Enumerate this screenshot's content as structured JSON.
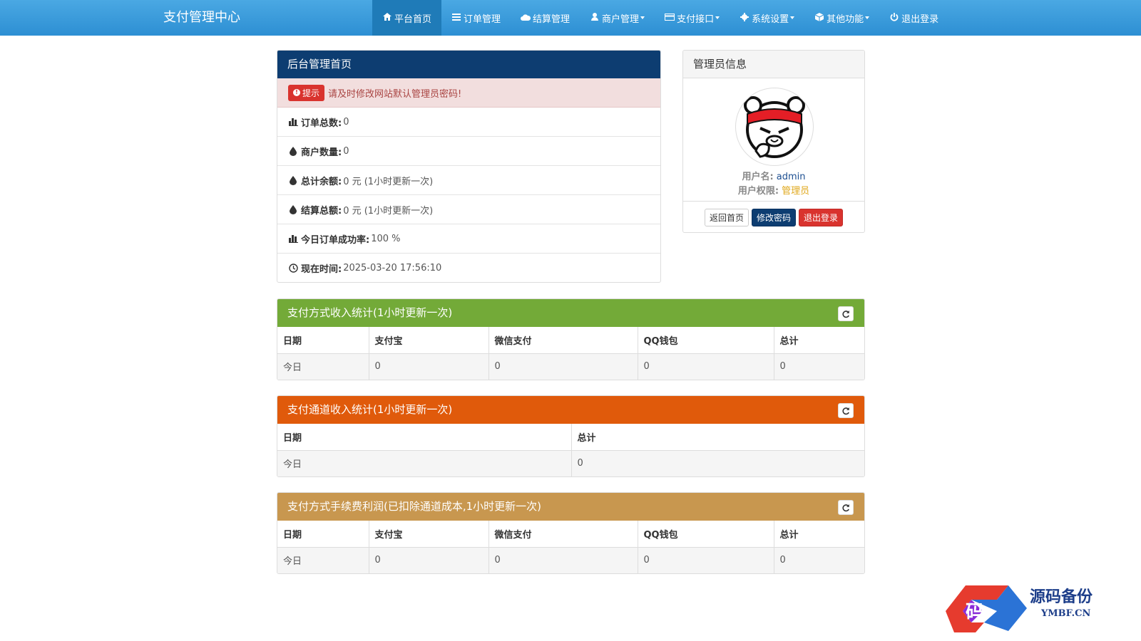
{
  "navbar": {
    "brand": "支付管理中心",
    "items": [
      {
        "label": "平台首页",
        "icon": "home-icon",
        "active": true,
        "dropdown": false
      },
      {
        "label": "订单管理",
        "icon": "list-icon",
        "active": false,
        "dropdown": false
      },
      {
        "label": "结算管理",
        "icon": "cloud-icon",
        "active": false,
        "dropdown": false
      },
      {
        "label": "商户管理",
        "icon": "user-icon",
        "active": false,
        "dropdown": true
      },
      {
        "label": "支付接口",
        "icon": "card-icon",
        "active": false,
        "dropdown": true
      },
      {
        "label": "系统设置",
        "icon": "gear-icon",
        "active": false,
        "dropdown": true
      },
      {
        "label": "其他功能",
        "icon": "cube-icon",
        "active": false,
        "dropdown": true
      },
      {
        "label": "退出登录",
        "icon": "power-icon",
        "active": false,
        "dropdown": false
      }
    ]
  },
  "main_panel": {
    "title": "后台管理首页",
    "alert_badge": "提示",
    "alert_text": "请及时修改网站默认管理员密码!",
    "stats": [
      {
        "icon": "bar-chart-icon",
        "label": "订单总数:",
        "value": "0"
      },
      {
        "icon": "drop-icon",
        "label": "商户数量:",
        "value": "0"
      },
      {
        "icon": "drop-icon",
        "label": "总计余额:",
        "value": "0 元 (1小时更新一次)"
      },
      {
        "icon": "drop-icon",
        "label": "结算总额:",
        "value": "0 元 (1小时更新一次)"
      },
      {
        "icon": "bar-chart-icon",
        "label": "今日订单成功率:",
        "value": "100 %"
      },
      {
        "icon": "clock-icon",
        "label": "现在时间:",
        "value": " 2025-03-20 17:56:10"
      }
    ]
  },
  "admin_panel": {
    "title": "管理员信息",
    "username_label": "用户名:",
    "username": "admin",
    "role_label": "用户权限:",
    "role": "管理员",
    "buttons": {
      "home": "返回首页",
      "change_password": "修改密码",
      "logout": "退出登录"
    }
  },
  "tables": {
    "method_income": {
      "title": "支付方式收入统计(1小时更新一次)",
      "headers": [
        "日期",
        "支付宝",
        "微信支付",
        "QQ钱包",
        "总计"
      ],
      "row": [
        "今日",
        "0",
        "0",
        "0",
        "0"
      ]
    },
    "channel_income": {
      "title": "支付通道收入统计(1小时更新一次)",
      "headers": [
        "日期",
        "总计"
      ],
      "row": [
        "今日",
        "0"
      ]
    },
    "fee_profit": {
      "title": "支付方式手续费利润(已扣除通道成本,1小时更新一次)",
      "headers": [
        "日期",
        "支付宝",
        "微信支付",
        "QQ钱包",
        "总计"
      ],
      "row": [
        "今日",
        "0",
        "0",
        "0",
        "0"
      ]
    }
  },
  "watermark": {
    "text": "源码备份",
    "url": "YMBF.CN",
    "logo_char": "码"
  },
  "colors": {
    "navbar": "#2d8fd3",
    "main_header": "#0d3d71",
    "method_header": "#73aa38",
    "channel_header": "#e05a0b",
    "fee_header": "#c8974f",
    "danger": "#d9332e",
    "role_text": "#e0a81c"
  }
}
